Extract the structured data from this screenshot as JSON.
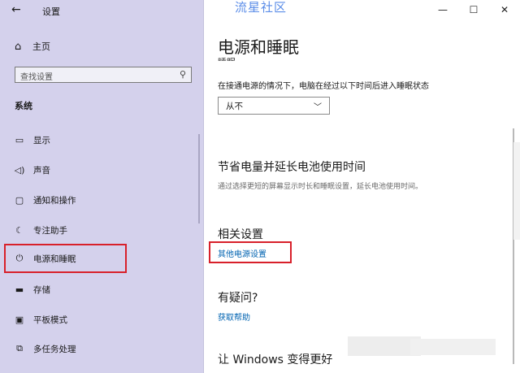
{
  "window": {
    "title": "设置",
    "watermark": "流星社区",
    "controls": {
      "minimize": "—",
      "maximize": "☐",
      "close": "✕"
    }
  },
  "sidebar": {
    "back_glyph": "←",
    "home_label": "主页",
    "search_placeholder": "查找设置",
    "section_label": "系统",
    "items": [
      {
        "icon": "monitor-icon",
        "label": "显示"
      },
      {
        "icon": "speaker-icon",
        "label": "声音"
      },
      {
        "icon": "notification-icon",
        "label": "通知和操作"
      },
      {
        "icon": "moon-icon",
        "label": "专注助手"
      },
      {
        "icon": "power-icon",
        "label": "电源和睡眠",
        "selected": true
      },
      {
        "icon": "storage-icon",
        "label": "存储"
      },
      {
        "icon": "tablet-icon",
        "label": "平板模式"
      },
      {
        "icon": "multitask-icon",
        "label": "多任务处理"
      }
    ]
  },
  "main": {
    "page_title": "电源和睡眠",
    "cut_heading": "睡眠",
    "sleep_label": "在接通电源的情况下，电脑在经过以下时间后进入睡眠状态",
    "sleep_value": "从不",
    "battery_heading": "节省电量并延长电池使用时间",
    "battery_desc": "通过选择更短的屏幕显示时长和睡眠设置，延长电池使用时间。",
    "related_heading": "相关设置",
    "related_link": "其他电源设置",
    "question_heading": "有疑问?",
    "help_link": "获取帮助",
    "improve_heading": "让 Windows 变得更好"
  },
  "colors": {
    "sidebar_bg": "#d4d1ec",
    "accent": "#0063b1",
    "highlight": "#d8202a"
  }
}
